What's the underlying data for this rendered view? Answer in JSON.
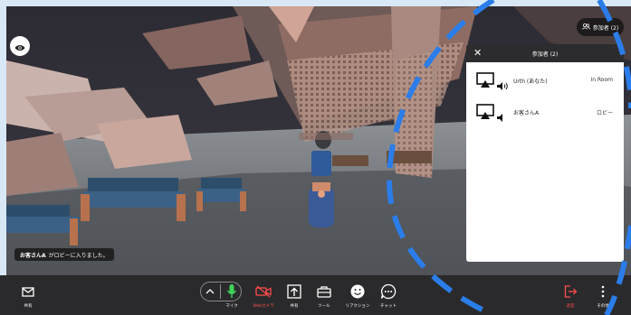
{
  "participants_button": {
    "label": "参加者 (2)"
  },
  "panel": {
    "title": "参加者 (2)",
    "rows": [
      {
        "name": "Urth (あなた)",
        "status": "In Room"
      },
      {
        "name": "お客さんA",
        "status": "ロビー"
      }
    ]
  },
  "toast": {
    "name": "お客さんA",
    "message": "がロビーに入りました。"
  },
  "toolbar": {
    "share_left": "共有",
    "mic": "マイク",
    "webcam": "Webカメラ",
    "share": "共有",
    "tools": "ツール",
    "reaction": "リアクション",
    "chat": "チャット",
    "leave": "退室",
    "more": "その他"
  },
  "colors": {
    "accent_red": "#ff4d4d",
    "mic_green": "#3fd35a",
    "bar_bg": "#2a2a2c",
    "decor_blue": "#2b7de9"
  }
}
